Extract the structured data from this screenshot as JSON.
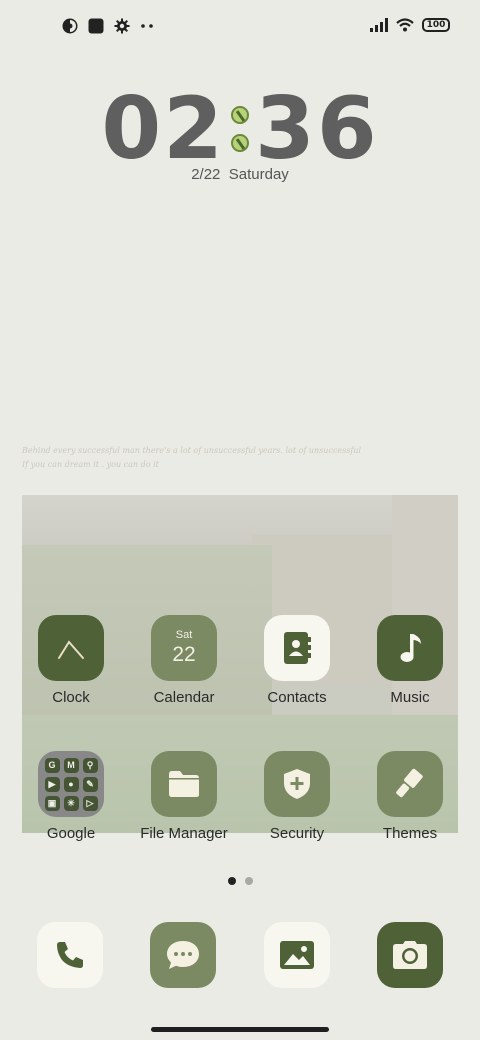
{
  "status_bar": {
    "left_icons": [
      "app-badge-icon",
      "square-icon",
      "gear-icon",
      "more-dots-icon"
    ],
    "right_icons": [
      "signal-icon",
      "wifi-icon"
    ],
    "battery_level": "100"
  },
  "clock": {
    "hours": "02",
    "minutes": "36",
    "date": "2/22",
    "weekday": "Saturday"
  },
  "quote": {
    "line1": "Behind every successful man there's a lot of unsuccessful years. lot of unsuccessful",
    "line2": "If you can dream it . you can do it"
  },
  "apps": [
    {
      "label": "Clock",
      "icon": "clock-icon"
    },
    {
      "label": "Calendar",
      "icon": "calendar-icon",
      "day": "Sat",
      "date": "22"
    },
    {
      "label": "Contacts",
      "icon": "contacts-icon"
    },
    {
      "label": "Music",
      "icon": "music-note-icon"
    },
    {
      "label": "Google",
      "icon": "folder-icon",
      "folder_items": [
        "G",
        "M",
        "⚲",
        "▶",
        "●",
        "✎",
        "▣",
        "✳",
        "▷"
      ]
    },
    {
      "label": "File Manager",
      "icon": "folder-file-icon"
    },
    {
      "label": "Security",
      "icon": "shield-plus-icon"
    },
    {
      "label": "Themes",
      "icon": "brush-icon"
    }
  ],
  "pager": {
    "pages": 2,
    "current": 1
  },
  "dock": [
    {
      "icon": "phone-icon"
    },
    {
      "icon": "message-icon"
    },
    {
      "icon": "gallery-icon"
    },
    {
      "icon": "camera-icon"
    }
  ],
  "colors": {
    "background": "#ebebe5",
    "accent_dark": "#4e6137",
    "accent_mid": "#7b8a62",
    "tile_light": "#f8f7ef"
  }
}
